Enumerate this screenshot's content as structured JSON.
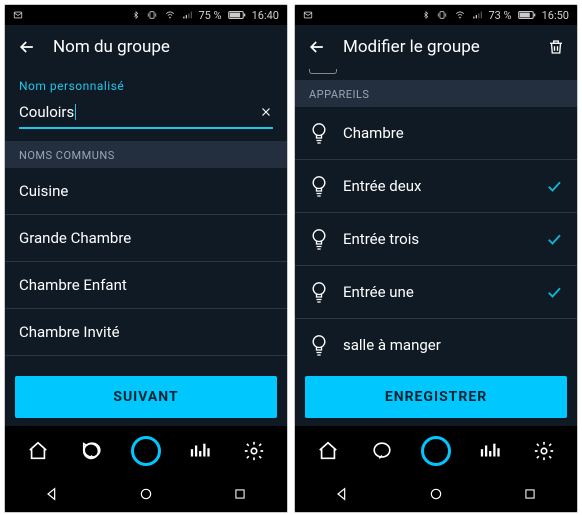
{
  "left": {
    "status": {
      "battery": "75 %",
      "time": "16:40"
    },
    "header": {
      "title": "Nom du groupe"
    },
    "custom_label": "Nom personnalisé",
    "input_value": "Couloirs",
    "section": "NOMS COMMUNS",
    "items": [
      {
        "label": "Cuisine"
      },
      {
        "label": "Grande Chambre"
      },
      {
        "label": "Chambre Enfant"
      },
      {
        "label": "Chambre Invité"
      }
    ],
    "cta": "SUIVANT"
  },
  "right": {
    "status": {
      "battery": "73 %",
      "time": "16:50"
    },
    "header": {
      "title": "Modifier le groupe"
    },
    "section": "APPAREILS",
    "devices": [
      {
        "label": "Chambre",
        "checked": false
      },
      {
        "label": "Entrée deux",
        "checked": true
      },
      {
        "label": "Entrée trois",
        "checked": true
      },
      {
        "label": "Entrée une",
        "checked": true
      },
      {
        "label": "salle à manger",
        "checked": false
      }
    ],
    "cta": "ENREGISTRER"
  }
}
